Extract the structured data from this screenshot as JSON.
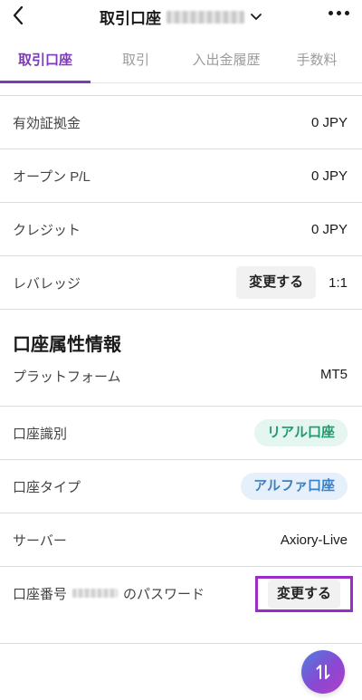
{
  "header": {
    "title": "取引口座",
    "back_icon": "chevron-left-icon",
    "dropdown_icon": "chevron-down-icon",
    "more_icon": "more-horizontal-icon"
  },
  "tabs": [
    {
      "label": "取引口座",
      "active": true
    },
    {
      "label": "取引",
      "active": false
    },
    {
      "label": "入出金履歴",
      "active": false
    },
    {
      "label": "手数料",
      "active": false
    }
  ],
  "account_rows": [
    {
      "label": "有効証拠金",
      "value": "0 JPY"
    },
    {
      "label": "オープン P/L",
      "value": "0 JPY"
    },
    {
      "label": "クレジット",
      "value": "0 JPY"
    }
  ],
  "leverage": {
    "label": "レバレッジ",
    "button": "変更する",
    "value": "1:1"
  },
  "attributes": {
    "title": "口座属性情報",
    "platform": {
      "label": "プラットフォーム",
      "value": "MT5"
    },
    "account_id": {
      "label": "口座識別",
      "value": "リアル口座"
    },
    "account_type": {
      "label": "口座タイプ",
      "value": "アルファ口座"
    },
    "server": {
      "label": "サーバー",
      "value": "Axiory-Live"
    },
    "password": {
      "label_prefix": "口座番号",
      "label_suffix": "のパスワード",
      "button": "変更する"
    }
  },
  "colors": {
    "accent": "#7d39b8",
    "highlight": "#9b2cc7",
    "green_pill": "#1e9a6d",
    "blue_pill": "#3b7fc4"
  },
  "fab_icon": "swap-vertical-icon"
}
